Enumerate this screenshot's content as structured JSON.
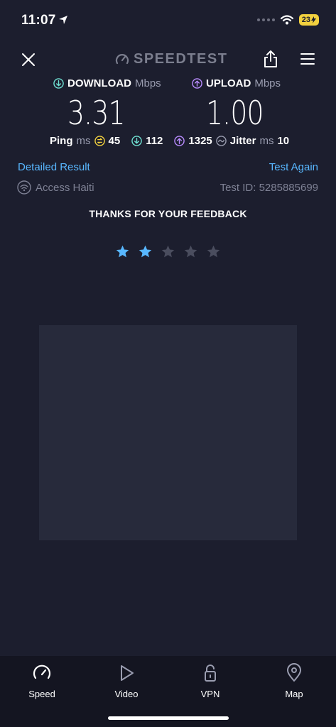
{
  "status_bar": {
    "time": "11:07",
    "battery": "23"
  },
  "header": {
    "logo": "SPEEDTEST"
  },
  "download": {
    "label": "DOWNLOAD",
    "unit": "Mbps",
    "value": "3.31"
  },
  "upload": {
    "label": "UPLOAD",
    "unit": "Mbps",
    "value": "1.00"
  },
  "ping": {
    "label": "Ping",
    "unit": "ms",
    "idle": "45",
    "download": "112",
    "upload": "1325"
  },
  "jitter": {
    "label": "Jitter",
    "unit": "ms",
    "value": "10"
  },
  "links": {
    "detailed_result": "Detailed Result",
    "test_again": "Test Again"
  },
  "provider": "Access Haiti",
  "test_id": "Test ID: 5285885699",
  "feedback": {
    "title": "THANKS FOR YOUR FEEDBACK",
    "rating": 2,
    "max_rating": 5
  },
  "colors": {
    "background": "#1c1e2e",
    "accent_blue": "#58b7ff",
    "download_teal": "#6fe0d2",
    "upload_purple": "#b98cff",
    "ping_yellow": "#f2d13f",
    "star_active": "#58b7ff",
    "star_inactive": "#4a4d5e"
  },
  "tabs": [
    {
      "label": "Speed",
      "icon": "speedometer-icon"
    },
    {
      "label": "Video",
      "icon": "play-icon"
    },
    {
      "label": "VPN",
      "icon": "lock-icon"
    },
    {
      "label": "Map",
      "icon": "map-pin-icon"
    }
  ]
}
